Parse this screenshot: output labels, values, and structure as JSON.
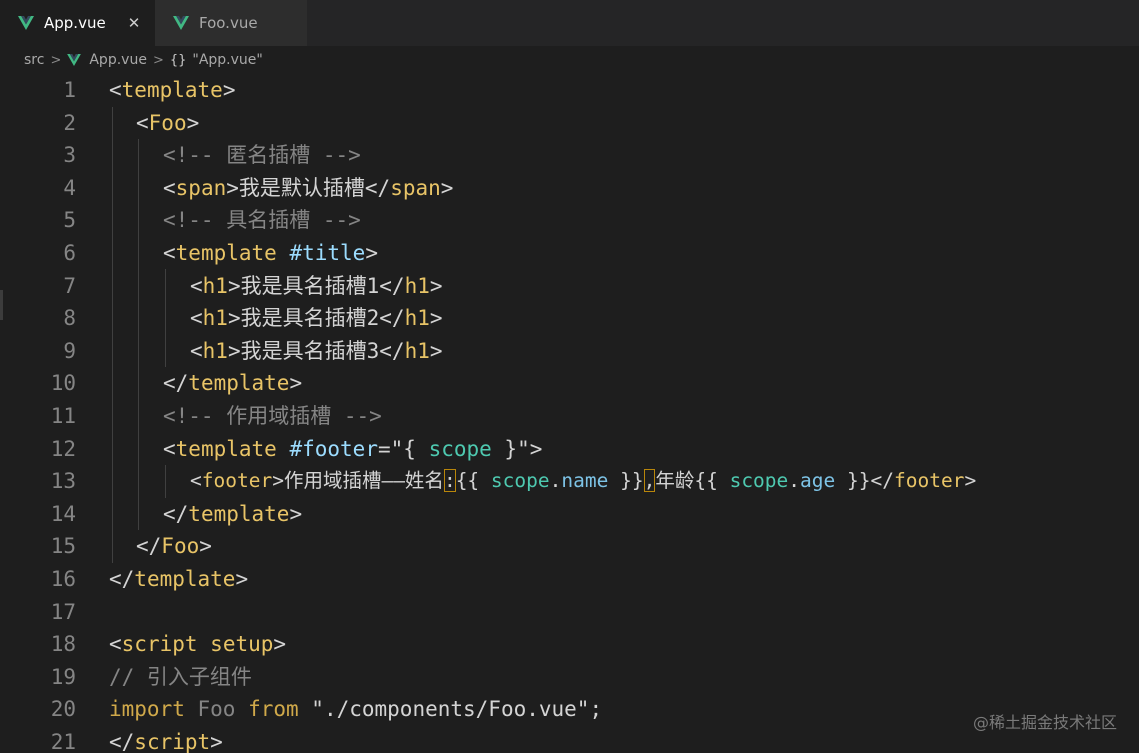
{
  "tabs": [
    {
      "label": "App.vue",
      "active": true
    },
    {
      "label": "Foo.vue",
      "active": false
    }
  ],
  "tab_close_glyph": "✕",
  "breadcrumb": {
    "folder": "src",
    "file": "App.vue",
    "symbol_glyph": "{}",
    "symbol": "\"App.vue\""
  },
  "line_numbers": [
    "1",
    "2",
    "3",
    "4",
    "5",
    "6",
    "7",
    "8",
    "9",
    "10",
    "11",
    "12",
    "13",
    "14",
    "15",
    "16",
    "17",
    "18",
    "19",
    "20",
    "21"
  ],
  "code": {
    "l1": {
      "open": "<",
      "tag": "template",
      "close": ">"
    },
    "l2": {
      "open": "<",
      "tag": "Foo",
      "close": ">"
    },
    "l3": {
      "comment": "<!-- 匿名插槽 -->"
    },
    "l4": {
      "open": "<",
      "tag": "span",
      "close": ">",
      "text": "我是默认插槽",
      "end_open": "</",
      "end_tag": "span",
      "end_close": ">"
    },
    "l5": {
      "comment": "<!-- 具名插槽 -->"
    },
    "l6": {
      "open": "<",
      "tag": "template",
      "space": " ",
      "attr": "#title",
      "close": ">"
    },
    "l7": {
      "open": "<",
      "tag": "h1",
      "close": ">",
      "text": "我是具名插槽1",
      "end_open": "</",
      "end_tag": "h1",
      "end_close": ">"
    },
    "l8": {
      "open": "<",
      "tag": "h1",
      "close": ">",
      "text": "我是具名插槽2",
      "end_open": "</",
      "end_tag": "h1",
      "end_close": ">"
    },
    "l9": {
      "open": "<",
      "tag": "h1",
      "close": ">",
      "text": "我是具名插槽3",
      "end_open": "</",
      "end_tag": "h1",
      "end_close": ">"
    },
    "l10": {
      "open": "</",
      "tag": "template",
      "close": ">"
    },
    "l11": {
      "comment": "<!-- 作用域插槽 -->"
    },
    "l12": {
      "open": "<",
      "tag": "template",
      "space": " ",
      "attr": "#footer",
      "eq": "=\"{ ",
      "var": "scope",
      "eq_end": " }\"",
      "close": ">"
    },
    "l13": {
      "open": "<",
      "tag": "footer",
      "close": ">",
      "text1": "作用域插槽——姓名",
      "colon": ":",
      "m1_open": "{{ ",
      "m1_obj": "scope",
      "m1_dot": ".",
      "m1_prop": "name",
      "m1_close": " }}",
      "comma": ",",
      "text2": "年龄",
      "m2_open": "{{ ",
      "m2_obj": "scope",
      "m2_dot": ".",
      "m2_prop": "age",
      "m2_close": " }}",
      "end_open": "</",
      "end_tag": "footer",
      "end_close": ">"
    },
    "l14": {
      "open": "</",
      "tag": "template",
      "close": ">"
    },
    "l15": {
      "open": "</",
      "tag": "Foo",
      "close": ">"
    },
    "l16": {
      "open": "</",
      "tag": "template",
      "close": ">"
    },
    "l18": {
      "open": "<",
      "tag": "script",
      "space": " ",
      "attr": "setup",
      "close": ">"
    },
    "l19": {
      "comment": "// 引入子组件"
    },
    "l20": {
      "kw1": "import",
      "name": " Foo ",
      "kw2": "from",
      "str": " \"./components/Foo.vue\"",
      "semi": ";"
    },
    "l21": {
      "open": "</",
      "tag": "script",
      "close": ">"
    }
  },
  "watermark": "@稀土掘金技术社区",
  "colors": {
    "background": "#1e1e1e",
    "tag": "#e8c467",
    "comment": "#858585",
    "vue_green": "#41b883"
  }
}
